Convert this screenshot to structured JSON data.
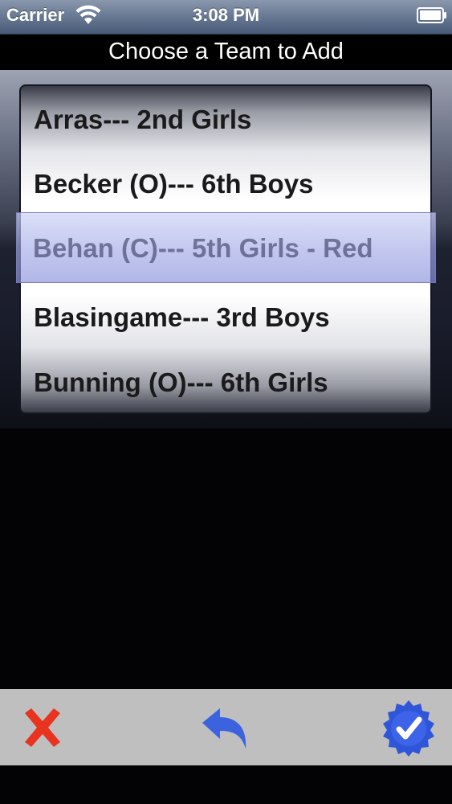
{
  "status_bar": {
    "carrier": "Carrier",
    "time": "3:08 PM",
    "wifi_icon": "wifi-icon",
    "battery_icon": "battery-icon"
  },
  "title": "Choose a Team to Add",
  "picker": {
    "items": [
      "Arras--- 2nd Girls",
      "Becker (O)--- 6th Boys",
      "Behan (C)--- 5th Girls - Red",
      "Blasingame--- 3rd Boys",
      "Bunning (O)--- 6th Girls"
    ],
    "selected": "Behan (C)--- 5th Girls - Red"
  },
  "toolbar": {
    "cancel_icon": "close-x-icon",
    "undo_icon": "undo-arrow-icon",
    "confirm_icon": "checkmark-badge-icon"
  },
  "colors": {
    "cancel": "#e8331f",
    "undo": "#3b63e0",
    "confirm": "#2f56d8",
    "toolbar_bg": "#bfbfbf"
  }
}
